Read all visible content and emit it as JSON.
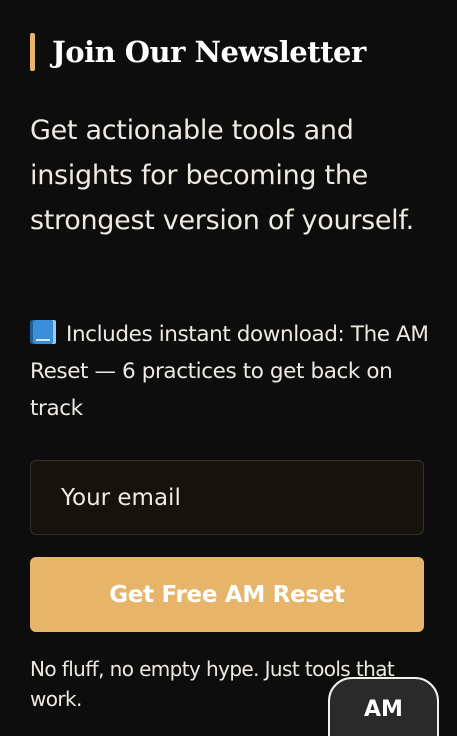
{
  "newsletter": {
    "title": "Join Our Newsletter",
    "accent_color": "#e6b56a",
    "lead": "Get actionable tools and insights for becoming the strongest version of yourself.",
    "includes_icon": "blue-book-icon",
    "includes_text": "Includes instant download: The AM Reset — 6 practices to get back on track",
    "email_placeholder": "Your email",
    "email_value": "",
    "submit_label": "Get Free AM Reset",
    "button_color": "#e6b56a",
    "footnote": "No fluff, no empty hype. Just tools that work."
  },
  "floating_badge": {
    "label": "AM"
  }
}
